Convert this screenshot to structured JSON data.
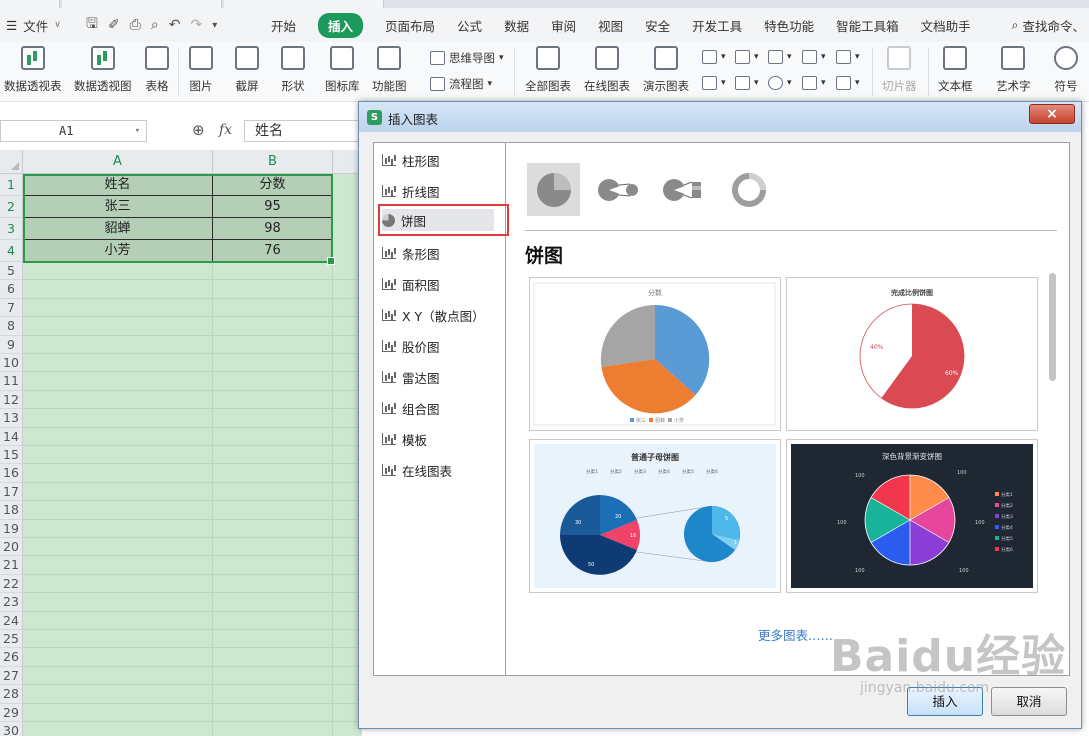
{
  "menubar": {
    "file_label": "文件",
    "tabs": [
      "开始",
      "插入",
      "页面布局",
      "公式",
      "数据",
      "审阅",
      "视图",
      "安全",
      "开发工具",
      "特色功能",
      "智能工具箱",
      "文档助手"
    ],
    "active_tab": "插入",
    "search_label": "查找命令、"
  },
  "ribbon": {
    "items": [
      "数据透视表",
      "数据透视图",
      "表格",
      "图片",
      "截屏",
      "形状",
      "图标库",
      "功能图",
      "全部图表",
      "在线图表",
      "演示图表",
      "切片器",
      "文本框",
      "艺术字",
      "符号"
    ],
    "mind_map": "思维导图",
    "flowchart": "流程图"
  },
  "formula_bar": {
    "cell_ref": "A1",
    "fx_label": "fx",
    "value": "姓名"
  },
  "sheet": {
    "columns": [
      "A",
      "B"
    ],
    "rows": [
      "1",
      "2",
      "3",
      "4",
      "5",
      "6",
      "7",
      "8",
      "9",
      "10",
      "11",
      "12",
      "13",
      "14",
      "15",
      "16",
      "17",
      "18",
      "19",
      "20",
      "21",
      "22",
      "23",
      "24",
      "25",
      "26",
      "27",
      "28",
      "29",
      "30"
    ],
    "header": [
      "姓名",
      "分数"
    ],
    "data": [
      [
        "张三",
        "95"
      ],
      [
        "貂蝉",
        "98"
      ],
      [
        "小芳",
        "76"
      ]
    ]
  },
  "dialog": {
    "title": "插入图表",
    "close_label": "×",
    "chart_types": [
      "柱形图",
      "折线图",
      "饼图",
      "条形图",
      "面积图",
      "X Y（散点图）",
      "股价图",
      "雷达图",
      "组合图",
      "模板",
      "在线图表"
    ],
    "selected_type": "饼图",
    "section_title": "饼图",
    "templates": [
      {
        "title": "分数",
        "legend": [
          "张三",
          "貂蝉",
          "小芳"
        ]
      },
      {
        "title": "完成比例饼图",
        "labels": [
          "40%",
          "60%"
        ]
      },
      {
        "title": "普通子母饼图",
        "legend": [
          "分类1",
          "分类2",
          "分类3",
          "分类4",
          "分类5",
          "分类6"
        ],
        "labels": [
          "30",
          "20",
          "16",
          "50",
          "5",
          "1"
        ]
      },
      {
        "title": "深色背景渐变饼图",
        "legend": [
          "分类1",
          "分类2",
          "分类3",
          "分类4",
          "分类5",
          "分类6"
        ],
        "labels": [
          "100",
          "100",
          "100",
          "100",
          "100",
          "100"
        ]
      }
    ],
    "more_label": "更多图表……",
    "insert_label": "插入",
    "cancel_label": "取消"
  },
  "watermark": {
    "brand": "Baidu经验",
    "url": "jingyan.baidu.com"
  },
  "colors": {
    "accent": "#1c9a5c",
    "selection": "#2c9a4b",
    "highlight": "#e03b3b",
    "link": "#3a78c9"
  }
}
